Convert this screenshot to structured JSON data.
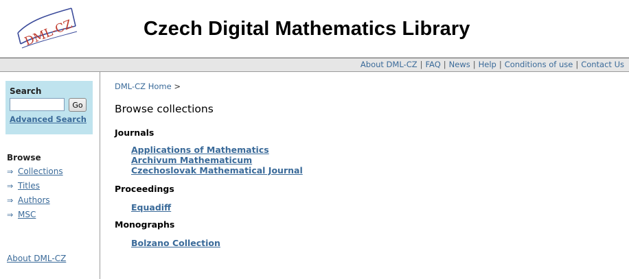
{
  "header": {
    "logo_text": "DML-CZ",
    "title": "Czech Digital Mathematics Library"
  },
  "topnav": {
    "items": [
      "About DML-CZ",
      "FAQ",
      "News",
      "Help",
      "Conditions of use",
      "Contact Us"
    ]
  },
  "sidebar": {
    "search": {
      "title": "Search",
      "input_value": "",
      "go_label": "Go",
      "advanced_label": "Advanced Search"
    },
    "browse": {
      "title": "Browse",
      "items": [
        "Collections",
        "Titles",
        "Authors",
        "MSC"
      ]
    },
    "about_label": "About DML-CZ"
  },
  "main": {
    "breadcrumb": {
      "home": "DML-CZ Home",
      "separator": ">"
    },
    "page_title": "Browse collections",
    "sections": [
      {
        "title": "Journals",
        "items": [
          "Applications of Mathematics",
          "Archivum Mathematicum",
          "Czechoslovak Mathematical Journal"
        ]
      },
      {
        "title": "Proceedings",
        "items": [
          "Equadiff"
        ]
      },
      {
        "title": "Monographs",
        "items": [
          "Bolzano Collection"
        ]
      }
    ]
  },
  "colors": {
    "link": "#3a6a99",
    "search_box_bg": "#bfe3ee",
    "topbar_bg": "#e6e6e6",
    "logo_red": "#c0392b"
  }
}
